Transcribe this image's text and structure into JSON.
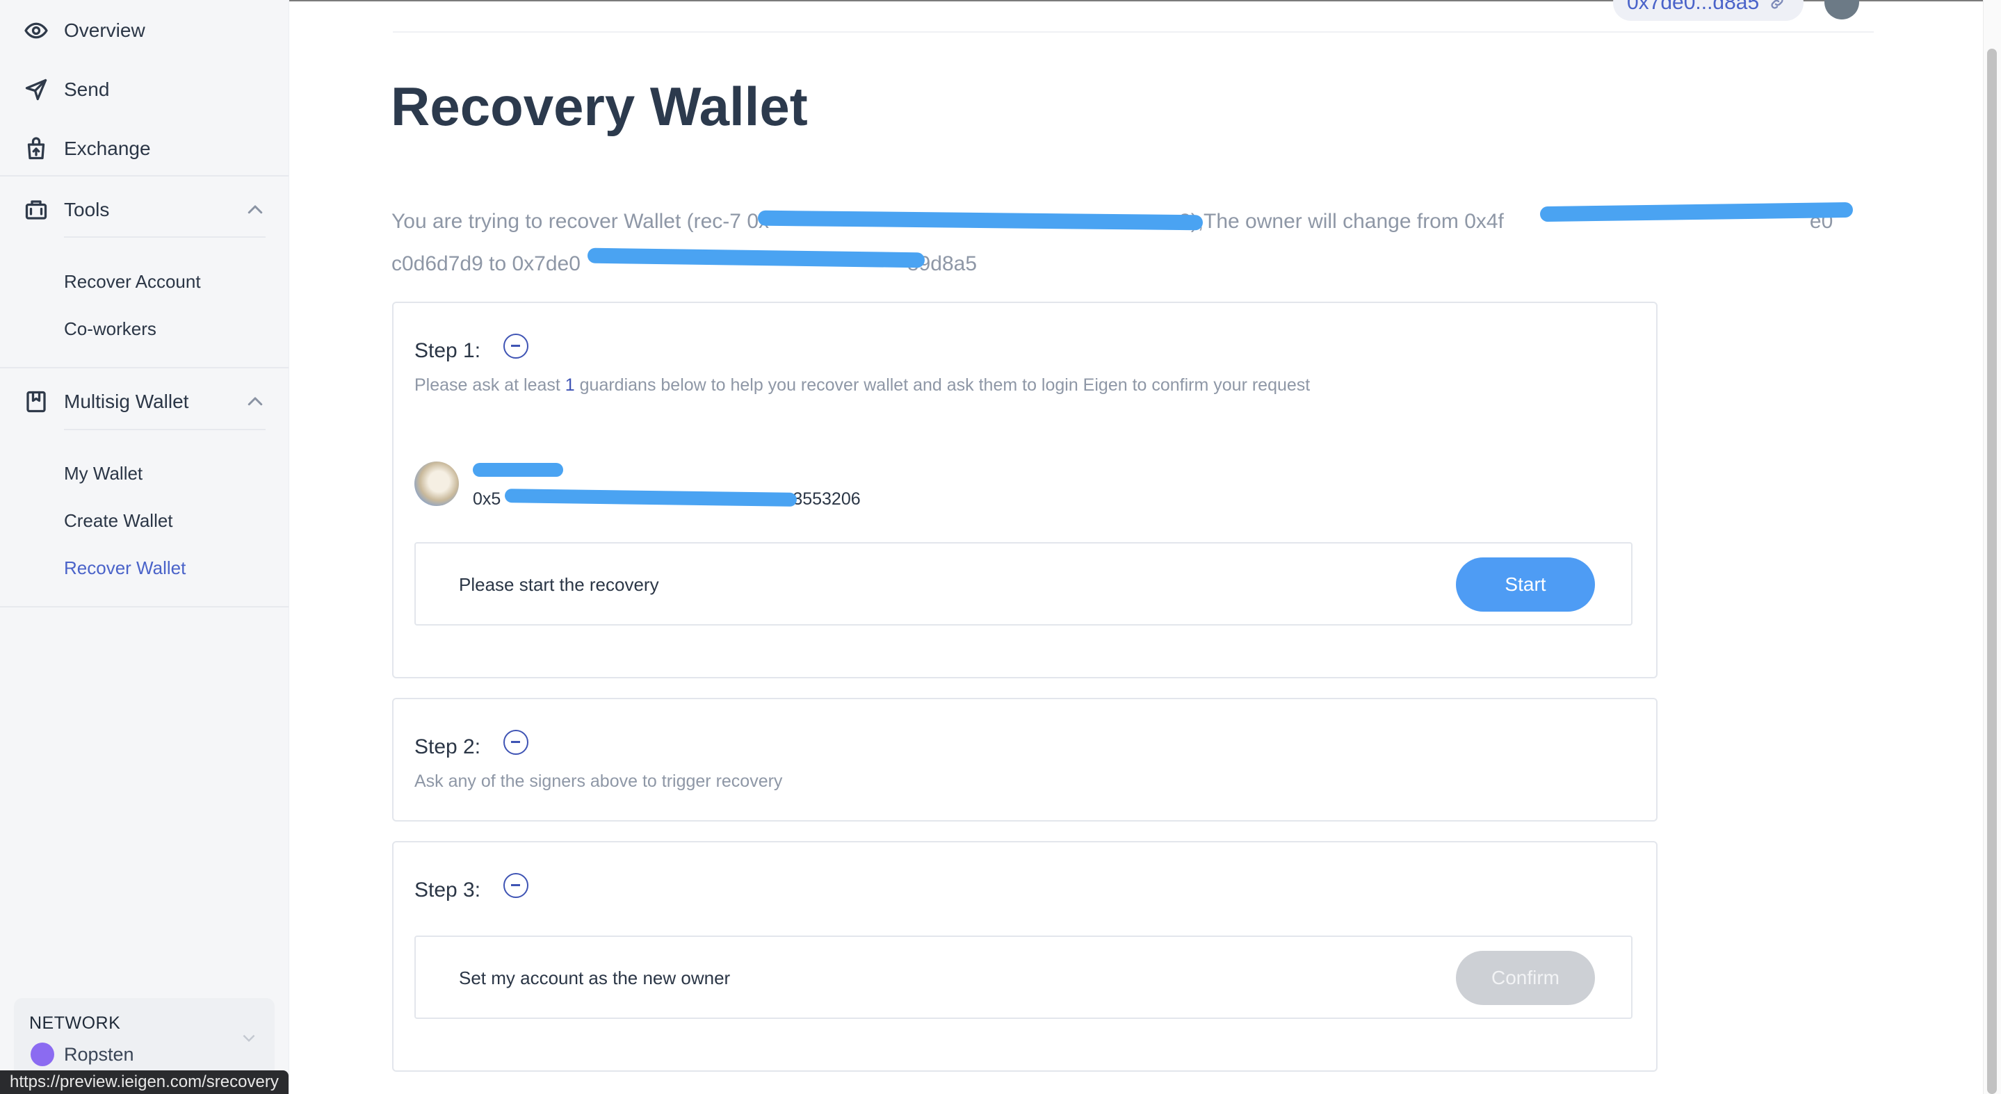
{
  "sidebar": {
    "nav": [
      {
        "label": "Overview",
        "icon": "eye-icon"
      },
      {
        "label": "Send",
        "icon": "send-icon"
      },
      {
        "label": "Exchange",
        "icon": "exchange-icon"
      }
    ],
    "tools": {
      "label": "Tools",
      "icon": "toolbox-icon",
      "expanded": true,
      "items": [
        "Recover Account",
        "Co-workers"
      ]
    },
    "multisig": {
      "label": "Multisig Wallet",
      "icon": "wallet-book-icon",
      "expanded": true,
      "items": [
        "My Wallet",
        "Create Wallet",
        "Recover Wallet"
      ],
      "active_item": "Recover Wallet"
    },
    "network": {
      "title": "NETWORK",
      "selected": "Ropsten",
      "dot_color": "#8b6bf1"
    }
  },
  "header": {
    "address": "0x7de0...d8a5",
    "link_icon": "link-icon"
  },
  "status_url": "https://preview.ieigen.com/srecovery",
  "main": {
    "title": "Recovery Wallet",
    "intro": {
      "line1_prefix": "You are trying to recover Wallet (rec-7 ",
      "line1_masked": "0x",
      "line1_wallet_tail": "3",
      "line1_middle": "),The owner will change from 0x4f",
      "line1_end": "e0",
      "line2_prefix": "c0d6d7d9 to 0x7de0",
      "line2_suffix": "89d8a5"
    },
    "step1": {
      "title": "Step 1:",
      "desc_prefix": "Please ask at least ",
      "desc_count": "1",
      "desc_suffix": " guardians below to help you recover wallet and ask them to login Eigen to confirm your request",
      "guardian": {
        "addr_prefix": "0x5",
        "addr_suffix": "3553206"
      },
      "action_text": "Please start the recovery",
      "button": "Start"
    },
    "step2": {
      "title": "Step 2:",
      "desc": "Ask any of the signers above to trigger recovery"
    },
    "step3": {
      "title": "Step 3:",
      "action_text": "Set my account as the new owner",
      "button": "Confirm"
    }
  },
  "colors": {
    "accent": "#3f54b4",
    "primary_button": "#4e9cf4",
    "disabled_button": "#cdd0d5",
    "redaction": "#4aa3f2"
  }
}
